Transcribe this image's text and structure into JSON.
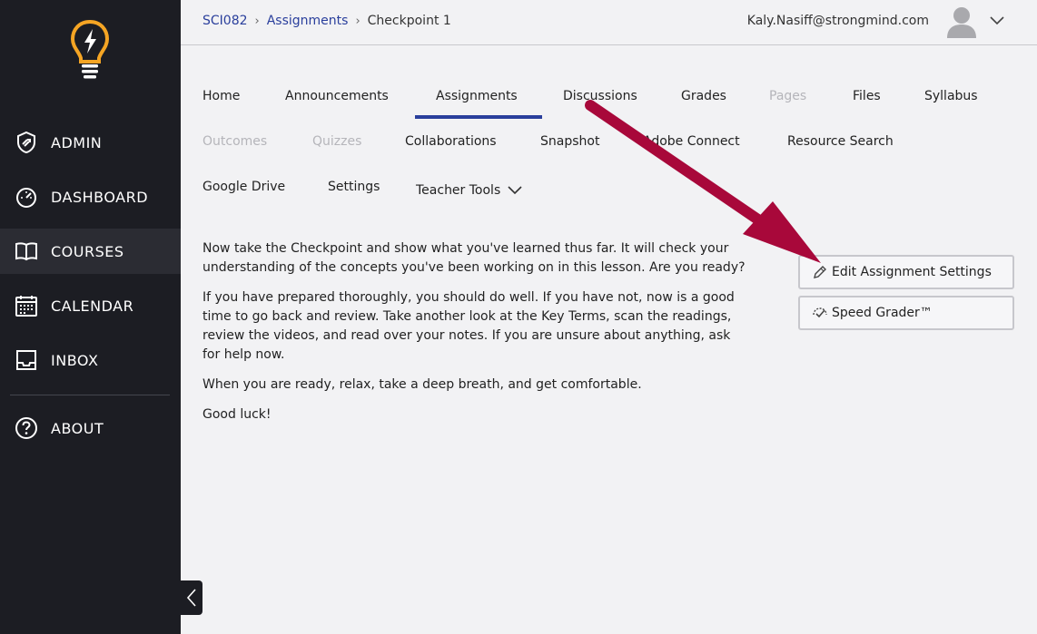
{
  "sidebar": {
    "items": [
      {
        "label": "ADMIN",
        "icon": "shield-icon"
      },
      {
        "label": "DASHBOARD",
        "icon": "gauge-icon"
      },
      {
        "label": "COURSES",
        "icon": "book-icon",
        "active": true
      },
      {
        "label": "CALENDAR",
        "icon": "calendar-icon"
      },
      {
        "label": "INBOX",
        "icon": "inbox-icon"
      },
      {
        "label": "ABOUT",
        "icon": "question-icon"
      }
    ]
  },
  "header": {
    "breadcrumb": [
      "SCI082",
      "Assignments",
      "Checkpoint 1"
    ],
    "user_email": "Kaly.Nasiff@strongmind.com"
  },
  "tabs": {
    "home": "Home",
    "announcements": "Announcements",
    "assignments": "Assignments",
    "discussions": "Discussions",
    "grades": "Grades",
    "pages": "Pages",
    "files": "Files",
    "syllabus": "Syllabus",
    "outcomes": "Outcomes",
    "quizzes": "Quizzes",
    "collaborations": "Collaborations",
    "snapshot": "Snapshot",
    "adobe_connect": "Adobe Connect",
    "resource_search": "Resource Search",
    "google_drive": "Google Drive",
    "settings": "Settings",
    "teacher_tools": "Teacher Tools",
    "active": "Assignments"
  },
  "content": {
    "paragraphs": [
      "Now take the Checkpoint and show what you've learned thus far. It will check your understanding of the concepts you've been working on in this lesson. Are you ready?",
      "If you have prepared thoroughly, you should do well. If you have not, now is a good time to go back and review. Take another look at the Key Terms, scan the readings, review the videos, and read over your notes. If you are unsure about anything, ask for help now.",
      "When you are ready, relax, take a deep breath, and get comfortable.",
      "Good luck!"
    ]
  },
  "actions": {
    "edit_settings": "Edit Assignment Settings",
    "speed_grader": "Speed Grader™"
  },
  "colors": {
    "sidebar_bg": "#1c1d23",
    "accent": "#2a3f9c",
    "logo": "#f5a524",
    "annotation_arrow": "#a8083a"
  }
}
